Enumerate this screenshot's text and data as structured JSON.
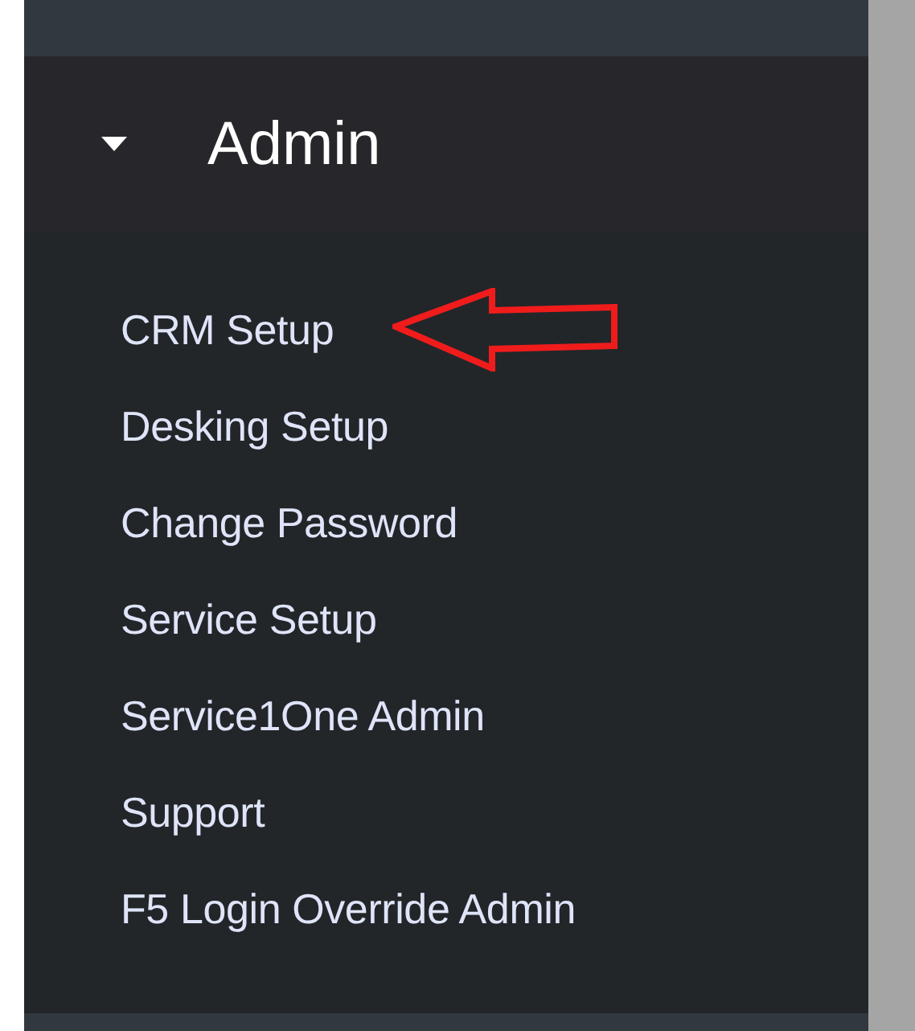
{
  "menu": {
    "title": "Admin",
    "expanded": true,
    "items": [
      {
        "label": "CRM Setup",
        "highlighted": true
      },
      {
        "label": "Desking Setup",
        "highlighted": false
      },
      {
        "label": "Change Password",
        "highlighted": false
      },
      {
        "label": "Service Setup",
        "highlighted": false
      },
      {
        "label": "Service1One Admin",
        "highlighted": false
      },
      {
        "label": "Support",
        "highlighted": false
      },
      {
        "label": "F5 Login Override Admin",
        "highlighted": false
      }
    ]
  }
}
